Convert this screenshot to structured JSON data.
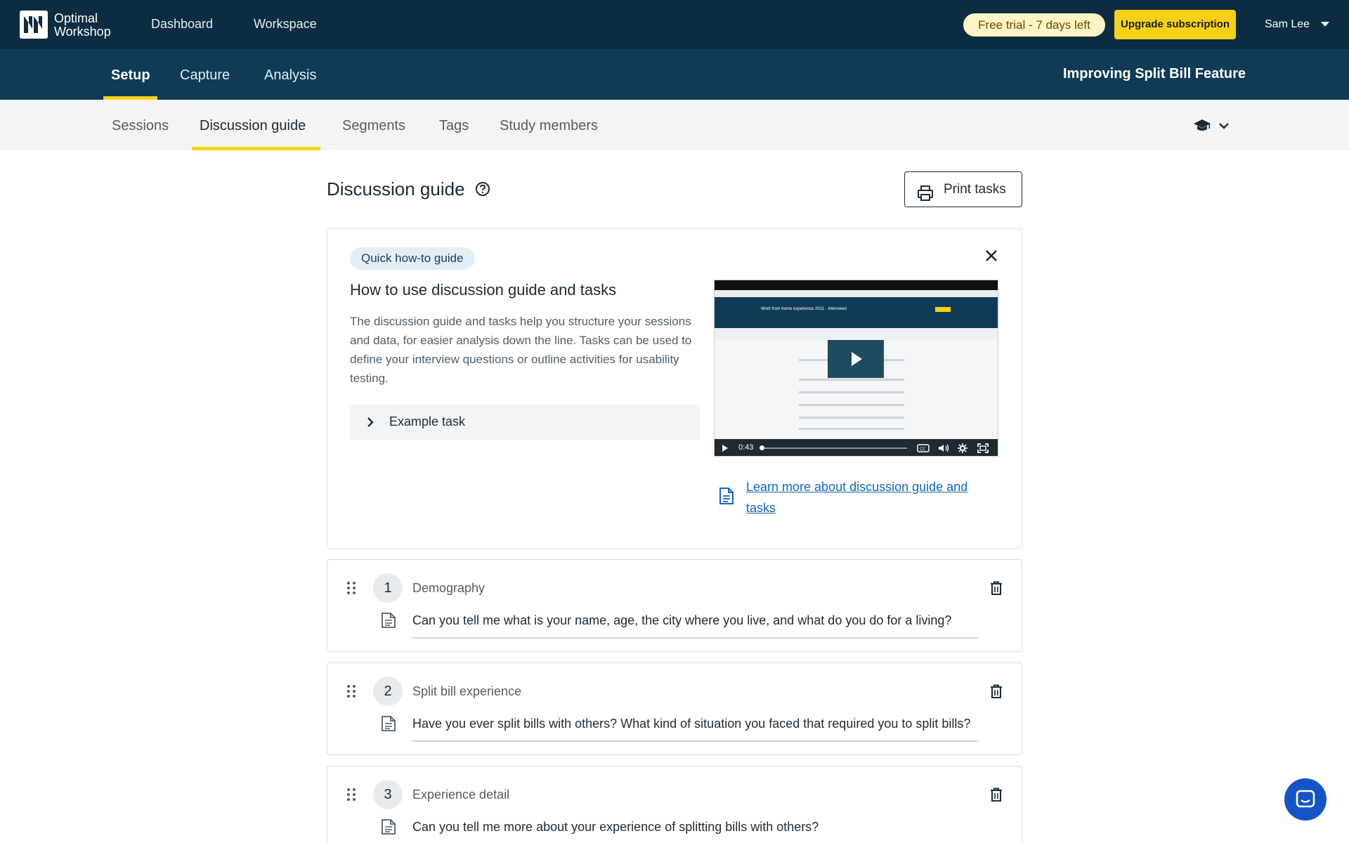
{
  "brand": {
    "name": "Optimal Workshop"
  },
  "topnav": {
    "items": [
      "Dashboard",
      "Workspace"
    ]
  },
  "trial": {
    "label": "Free trial - 7 days left"
  },
  "upgrade": {
    "label": "Upgrade subscription"
  },
  "user": {
    "name": "Sam Lee"
  },
  "subnav": {
    "items": [
      "Setup",
      "Capture",
      "Analysis"
    ],
    "active": "Setup"
  },
  "study": {
    "title": "Improving Split Bill Feature"
  },
  "tabs": {
    "items": [
      "Sessions",
      "Discussion guide",
      "Segments",
      "Tags",
      "Study members"
    ],
    "active": "Discussion guide"
  },
  "page": {
    "title": "Discussion guide",
    "print_label": "Print tasks"
  },
  "guide": {
    "badge": "Quick how-to guide",
    "heading": "How to use discussion guide and tasks",
    "body": "The discussion guide and tasks help you structure your sessions and data, for easier analysis down the line. Tasks can be used to define your interview questions or outline activities for usability testing.",
    "example_label": "Example task",
    "video_time": "0:43",
    "video_title": "Work from home experience 2021 - interviews",
    "link_text": "Learn more about discussion guide and tasks"
  },
  "tasks": [
    {
      "number": "1",
      "title": "Demography",
      "question": "Can you tell me what is your name, age, the city where you live, and what do you do for a living?"
    },
    {
      "number": "2",
      "title": "Split bill experience",
      "question": "Have you ever split bills with others? What kind of situation you faced that required you to split bills?"
    },
    {
      "number": "3",
      "title": "Experience detail",
      "question": "Can you tell me more about your experience of splitting bills with others?"
    }
  ],
  "colors": {
    "header": "#0c2c42",
    "subheader": "#0f3b57",
    "accent": "#f7d117",
    "link": "#1565c0",
    "chat": "#1454c8"
  },
  "icons": [
    "optimal-workshop-logo",
    "caret-down-icon",
    "graduation-cap-icon",
    "chevron-down-icon",
    "question-circle-icon",
    "printer-icon",
    "close-icon",
    "chevron-right-icon",
    "play-icon",
    "document-icon",
    "drag-handle-icon",
    "trash-icon",
    "chat-icon"
  ]
}
